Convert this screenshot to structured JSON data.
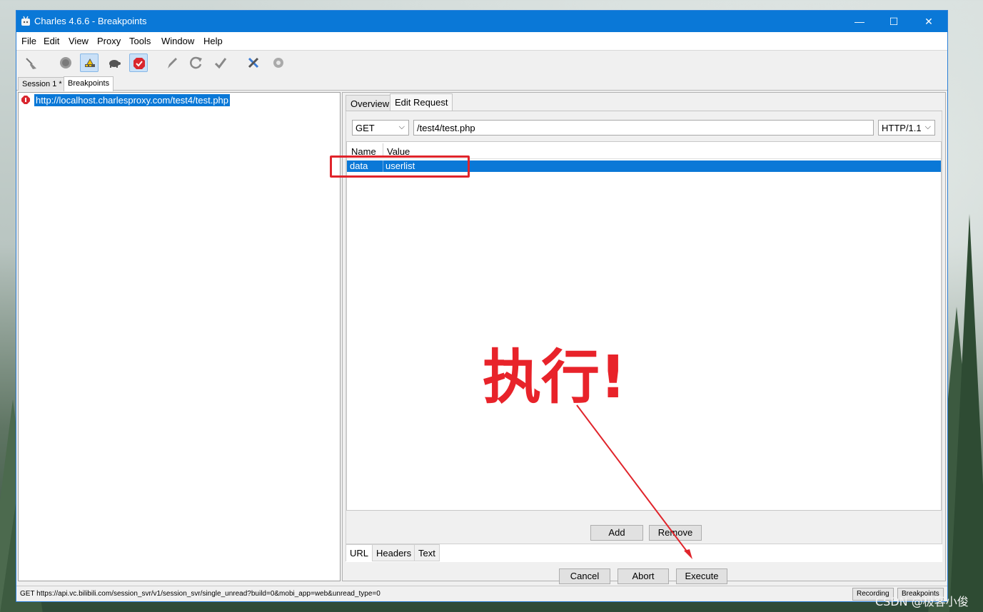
{
  "window": {
    "title": "Charles 4.6.6 - Breakpoints",
    "min": "—",
    "max": "☐",
    "close": "✕"
  },
  "menu": [
    "File",
    "Edit",
    "View",
    "Proxy",
    "Tools",
    "Window",
    "Help"
  ],
  "toolbar": {
    "buttons": [
      "broom-icon",
      "record-icon",
      "throttle-icon",
      "turtle-icon",
      "breakpoint-icon",
      "pen-icon",
      "refresh-icon",
      "check-icon",
      "tools-icon",
      "gear-icon"
    ],
    "active": [
      "throttle-icon",
      "breakpoint-icon"
    ]
  },
  "session_tabs": [
    "Session 1 *",
    "Breakpoints"
  ],
  "tree": {
    "url": "http://localhost.charlesproxy.com/test4/test.php"
  },
  "right": {
    "tabs": [
      "Overview",
      "Edit Request"
    ],
    "method": "GET",
    "path": "/test4/test.php",
    "protocol": "HTTP/1.1",
    "columns": [
      "Name",
      "Value"
    ],
    "params": [
      {
        "name": "data",
        "value": "userlist"
      }
    ],
    "add": "Add",
    "remove": "Remove",
    "bottom_tabs": [
      "URL",
      "Headers",
      "Text"
    ],
    "cancel": "Cancel",
    "abort": "Abort",
    "execute": "Execute"
  },
  "status": {
    "text": "GET https://api.vc.bilibili.com/session_svr/v1/session_svr/single_unread?build=0&mobi_app=web&unread_type=0",
    "recording": "Recording",
    "breakpoints": "Breakpoints"
  },
  "annotation": {
    "text": "执行!",
    "color": "#e8232a"
  },
  "watermark": "CSDN @极客小俊",
  "colors": {
    "titlebar": "#0a78d7",
    "selection": "#0a78d7",
    "annotation": "#e0242b"
  }
}
